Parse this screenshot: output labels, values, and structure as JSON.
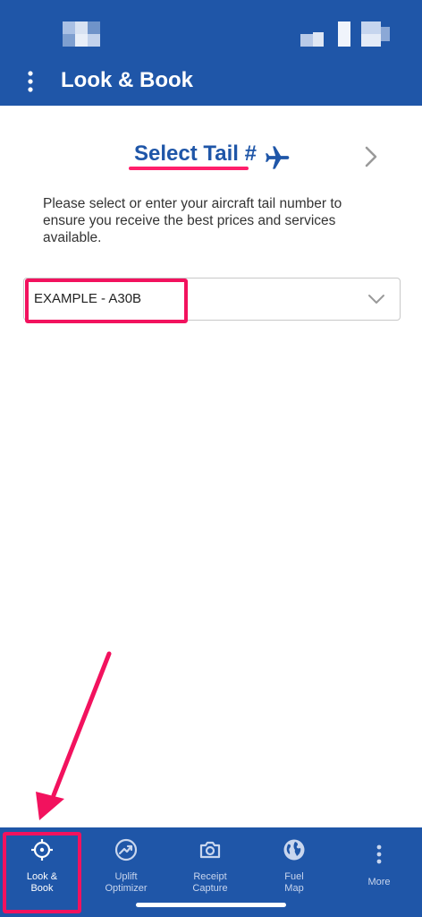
{
  "app_bar": {
    "title": "Look & Book"
  },
  "tail_select": {
    "heading": "Select Tail #",
    "instructions": "Please select or enter your aircraft tail number to ensure you receive the best prices and services available.",
    "selected_value": "EXAMPLE - A30B"
  },
  "bottom_nav": {
    "items": [
      {
        "label": "Look &\nBook",
        "icon": "crosshair-icon",
        "active": true
      },
      {
        "label": "Uplift\nOptimizer",
        "icon": "trend-up-icon",
        "active": false
      },
      {
        "label": "Receipt\nCapture",
        "icon": "camera-icon",
        "active": false
      },
      {
        "label": "Fuel\nMap",
        "icon": "globe-icon",
        "active": false
      },
      {
        "label": "More",
        "icon": "more-vertical-icon",
        "active": false
      }
    ]
  },
  "colors": {
    "brand_blue": "#1f56a8",
    "annotation_pink": "#f2125e"
  }
}
